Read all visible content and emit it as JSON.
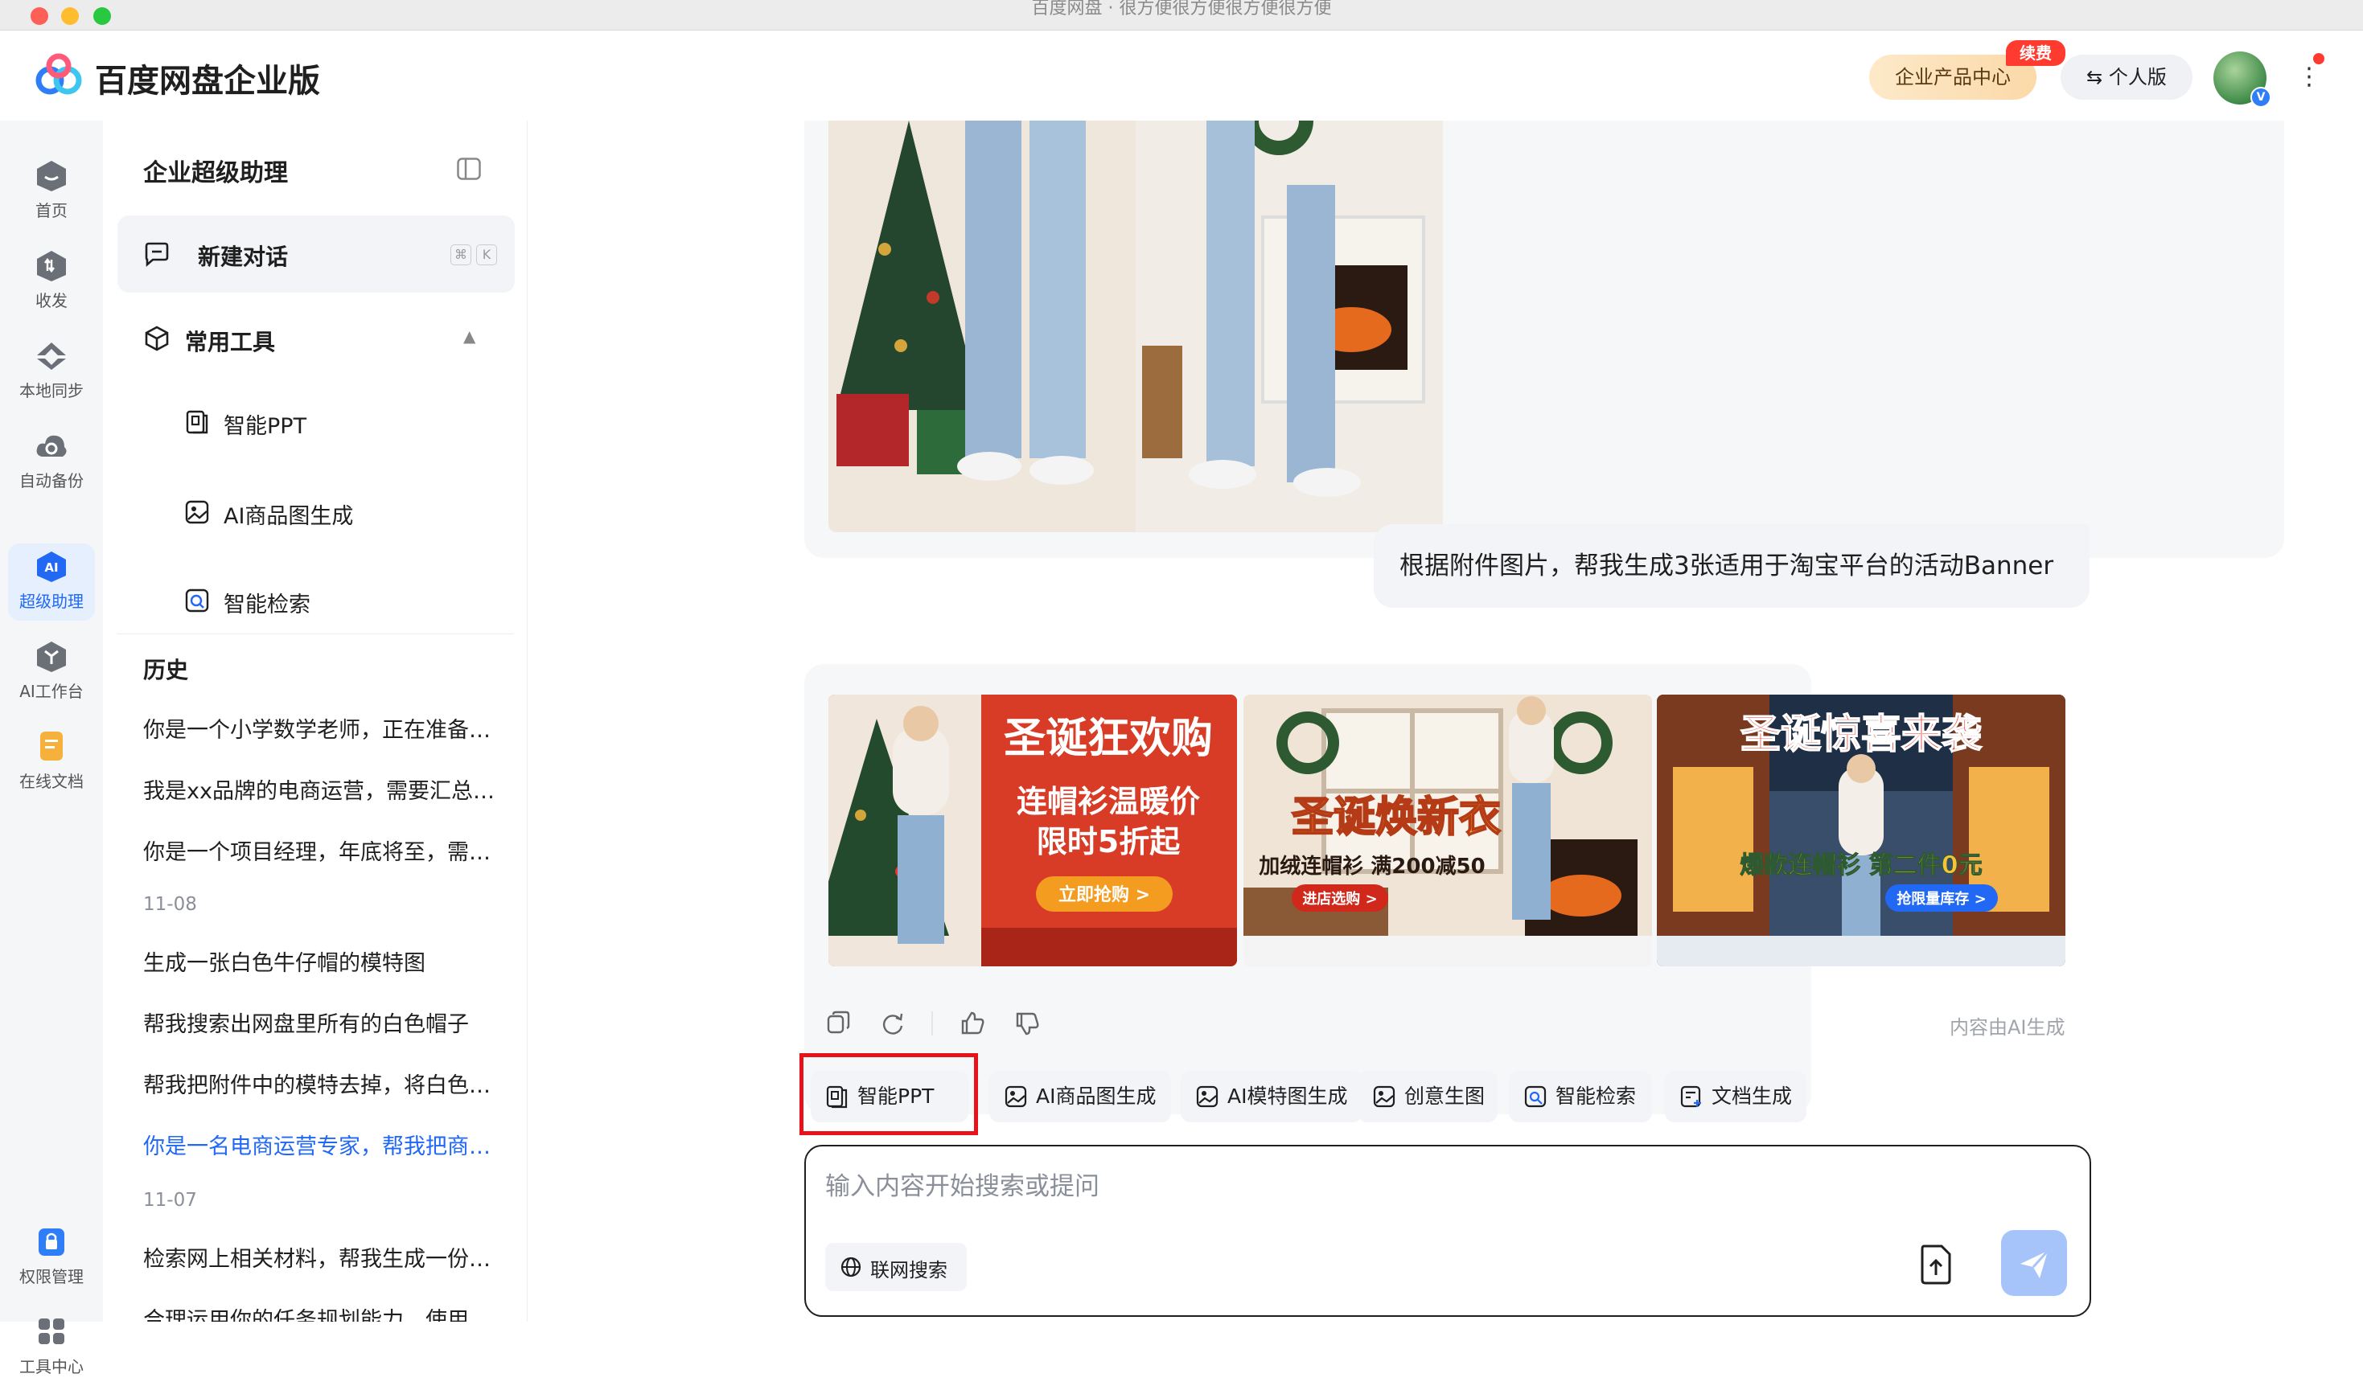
{
  "window": {
    "title": "百度网盘 · 很方便很方便很方便很方便"
  },
  "header": {
    "brand": "百度网盘企业版",
    "enterprise_center": "企业产品中心",
    "renew_badge": "续费",
    "personal_label": "个人版",
    "avatar_badge": "V"
  },
  "rail": {
    "items": [
      {
        "label": "首页",
        "icon": "home-icon"
      },
      {
        "label": "收发",
        "icon": "transfer-icon"
      },
      {
        "label": "本地同步",
        "icon": "sync-icon"
      },
      {
        "label": "自动备份",
        "icon": "backup-icon"
      },
      {
        "label": "超级助理",
        "icon": "ai-icon",
        "active": true
      },
      {
        "label": "AI工作台",
        "icon": "ai-workbench-icon"
      },
      {
        "label": "在线文档",
        "icon": "online-doc-icon"
      },
      {
        "label": "权限管理",
        "icon": "lock-icon"
      },
      {
        "label": "工具中心",
        "icon": "grid-icon"
      }
    ]
  },
  "sidebar": {
    "title": "企业超级助理",
    "new_chat": "新建对话",
    "shortcut_keys": [
      "⌘",
      "K"
    ],
    "tools_header": "常用工具",
    "tools": [
      "智能PPT",
      "AI商品图生成",
      "智能检索"
    ],
    "history_header": "历史",
    "history": [
      {
        "text": "你是一个小学数学老师，正在准备下节课的教学内容"
      },
      {
        "text": "我是xx品牌的电商运营，需要汇总最近的活动数据"
      },
      {
        "text": "你是一个项目经理，年底将至，需要整理年终总结"
      }
    ],
    "history_date_1": "11-08",
    "history_2": [
      {
        "text": "生成一张白色牛仔帽的模特图"
      },
      {
        "text": "帮我搜索出网盘里所有的白色帽子"
      },
      {
        "text": "帮我把附件中的模特去掉，将白色帽子放在桌面上"
      },
      {
        "text": "你是一名电商运营专家，帮我把商品图做成Banner",
        "active": true
      }
    ],
    "history_date_2": "11-07",
    "history_3": [
      {
        "text": "检索网上相关材料，帮我生成一份调研报告"
      },
      {
        "text": "合理运用你的任务规划能力，使用工具完成任务"
      }
    ]
  },
  "chat": {
    "user_message": "根据附件图片，帮我生成3张适用于淘宝平台的活动Banner",
    "banners": [
      {
        "headline": "圣诞狂欢购",
        "line1": "连帽衫温暖价",
        "line2": "限时5折起",
        "cta": "立即抢购 >"
      },
      {
        "headline": "圣诞焕新衣",
        "line1": "加绒连帽衫 满200减50",
        "cta": "进店选购 >"
      },
      {
        "headline": "圣诞惊喜来袭",
        "line1": "爆款连帽衫 第二件0元",
        "cta": "抢限量库存 >"
      }
    ],
    "ai_note": "内容由AI生成",
    "chips": [
      "智能PPT",
      "AI商品图生成",
      "AI模特图生成",
      "创意生图",
      "智能检索",
      "文档生成"
    ],
    "composer_placeholder": "输入内容开始搜索或提问",
    "web_search": "联网搜索"
  },
  "colors": {
    "accent": "#2168f5",
    "highlight": "#e8121a",
    "send": "#a7c4fa"
  }
}
